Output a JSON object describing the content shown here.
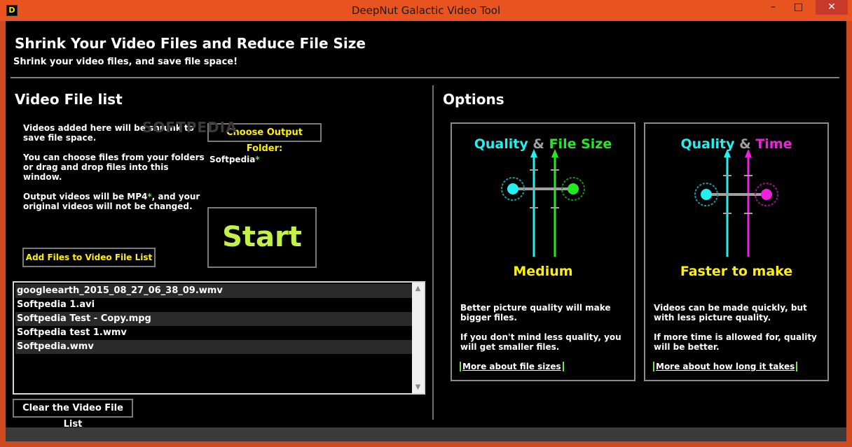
{
  "window": {
    "title": "DeepNut Galactic Video Tool",
    "icon_letter": "D",
    "minimize": "–",
    "maximize": "□",
    "close": "✕"
  },
  "header": {
    "title": "Shrink Your Video Files and Reduce File Size",
    "subtitle": "Shrink your video files, and save file space!"
  },
  "video_list": {
    "title": "Video File list",
    "info1": "Videos added here will be shrunk to save file space.",
    "info2": "You can choose files from your folders or drag and drop files into this window.",
    "info3_prefix": "Output videos will be ",
    "info3_format": "MP4",
    "info3_star": "*",
    "info3_suffix": ", and your original videos will not be changed.",
    "choose_folder_label": "Choose Output Folder:",
    "output_folder": "Softpedia",
    "output_folder_star": "*",
    "start_label": "Start",
    "add_files_label": "Add Files to Video File List",
    "files": [
      "googleearth_2015_08_27_06_38_09.wmv",
      "Softpedia 1.avi",
      "Softpedia Test - Copy.mpg",
      "Softpedia test 1.wmv",
      "Softpedia.wmv"
    ],
    "clear_label": "Clear the Video File List"
  },
  "options": {
    "title": "Options",
    "quality_size": {
      "title_a": "Quality",
      "title_amp": "&",
      "title_b": "File Size",
      "value": "Medium",
      "text1": "Better picture quality will make bigger files.",
      "text2": "If you don't mind less quality, you will get smaller files.",
      "link": "More about file sizes",
      "color_a": "#24f0f0",
      "color_b": "#24e824"
    },
    "quality_time": {
      "title_a": "Quality",
      "title_amp": "&",
      "title_b": "Time",
      "value": "Faster to make",
      "text1": "Videos can be made quickly, but with less picture quality.",
      "text2": "If more time is allowed for, quality will be better.",
      "link": "More about how long it takes",
      "color_a": "#24f0f0",
      "color_b": "#f020e0"
    }
  },
  "watermark": "SOFTPEDIA"
}
